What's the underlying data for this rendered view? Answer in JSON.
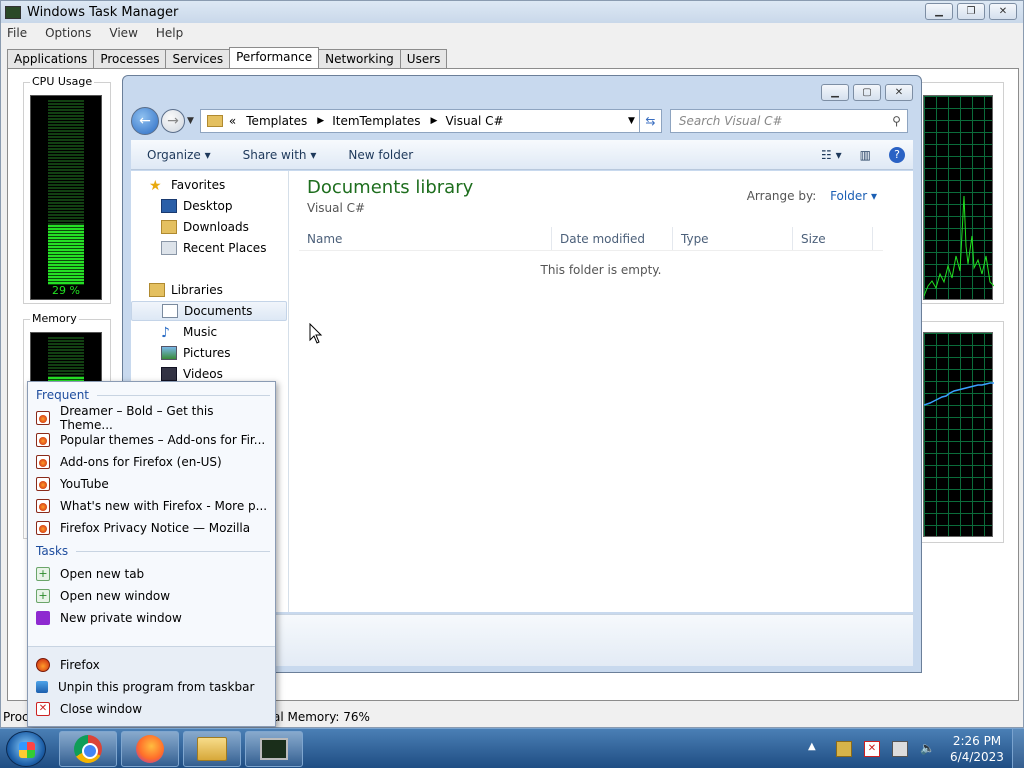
{
  "taskmanager": {
    "title": "Windows Task Manager",
    "menu": [
      "File",
      "Options",
      "View",
      "Help"
    ],
    "tabs": [
      "Applications",
      "Processes",
      "Services",
      "Performance",
      "Networking",
      "Users"
    ],
    "active_tab": "Performance",
    "cpu_label": "CPU Usage",
    "cpu_percent": "29 %",
    "memory_label": "Memory",
    "status_left": "Proc",
    "status_memory": "al Memory: 76%"
  },
  "explorer": {
    "address": [
      "Templates",
      "ItemTemplates",
      "Visual C#"
    ],
    "address_prefix": "«",
    "search_placeholder": "Search Visual C#",
    "commands": [
      "Organize",
      "Share with",
      "New folder"
    ],
    "nav": {
      "favorites": "Favorites",
      "desktop": "Desktop",
      "downloads": "Downloads",
      "recent": "Recent Places",
      "libraries": "Libraries",
      "documents": "Documents",
      "music": "Music",
      "pictures": "Pictures",
      "videos": "Videos"
    },
    "library_title": "Documents library",
    "library_subtitle": "Visual C#",
    "arrange_label": "Arrange by:",
    "arrange_value": "Folder",
    "columns": [
      "Name",
      "Date modified",
      "Type",
      "Size"
    ],
    "empty_text": "This folder is empty."
  },
  "jumplist": {
    "frequent_header": "Frequent",
    "frequent": [
      "Dreamer – Bold – Get this Theme...",
      "Popular themes – Add-ons for Fir...",
      "Add-ons for Firefox (en-US)",
      "YouTube",
      "What's new with Firefox - More p...",
      "Firefox Privacy Notice — Mozilla"
    ],
    "tasks_header": "Tasks",
    "tasks": [
      "Open new tab",
      "Open new window",
      "New private window"
    ],
    "app": "Firefox",
    "unpin": "Unpin this program from taskbar",
    "close": "Close window"
  },
  "taskbar": {
    "time": "2:26 PM",
    "date": "6/4/2023"
  }
}
